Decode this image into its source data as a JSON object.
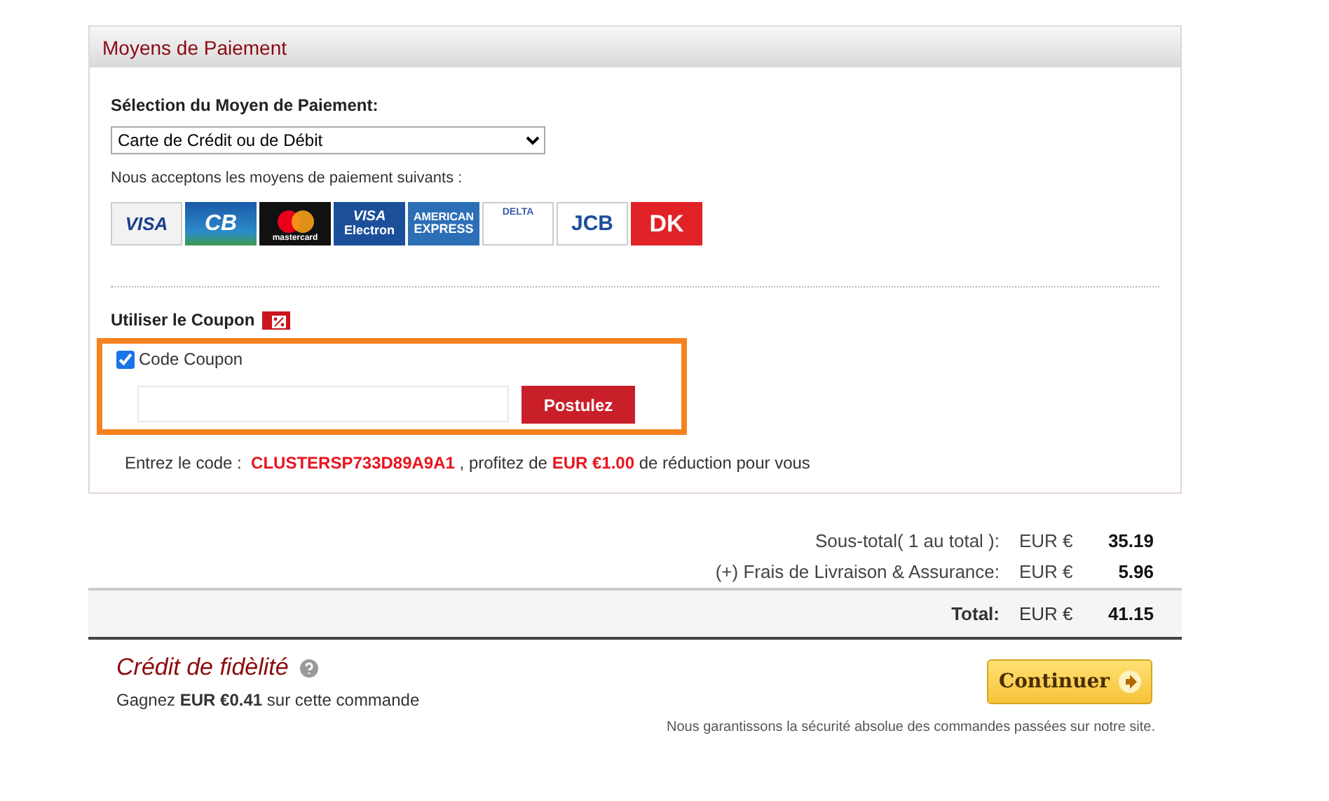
{
  "panel": {
    "title": "Moyens de Paiement"
  },
  "payment": {
    "label": "Sélection du Moyen de Paiement:",
    "selected_option": "Carte de Crédit ou de Débit",
    "accepted_text": "Nous acceptons les moyens de paiement suivants :",
    "cards": [
      {
        "kind": "visa",
        "label": "VISA"
      },
      {
        "kind": "cb",
        "label": "CB"
      },
      {
        "kind": "mastercard",
        "label": "mastercard"
      },
      {
        "kind": "electron",
        "label": "VISA",
        "sub": "Electron"
      },
      {
        "kind": "amex",
        "label": "AMERICAN",
        "sub": "EXPRESS"
      },
      {
        "kind": "delta",
        "label": "DELTA"
      },
      {
        "kind": "jcb",
        "label": "JCB"
      },
      {
        "kind": "dk",
        "label": "DK"
      }
    ]
  },
  "coupon": {
    "title": "Utiliser le Coupon",
    "checkbox_label": "Code Coupon",
    "checked": true,
    "apply_button": "Postulez",
    "hint": "Entrez le code :  **CLUSTERSP733D89A9A1** , profitez de **EUR €1.00** de réduction pour vous"
  },
  "totals": [
    {
      "label": "Sous-total( 1 au total ):",
      "currency": "EUR €",
      "amount": "35.19"
    },
    {
      "label": "(+) Frais de Livraison & Assurance:",
      "currency": "EUR €",
      "amount": "5.96"
    }
  ],
  "grand_total": {
    "label": "Total:",
    "currency": "EUR €",
    "amount": "41.15"
  },
  "loyalty": {
    "title": "Crédit de fidèlité",
    "text": "Gagnez **EUR €0.41** sur cette commande"
  },
  "continue_button": "Continuer",
  "guarantee": "Nous garantissons la sécurité absolue des commandes passées sur notre site."
}
